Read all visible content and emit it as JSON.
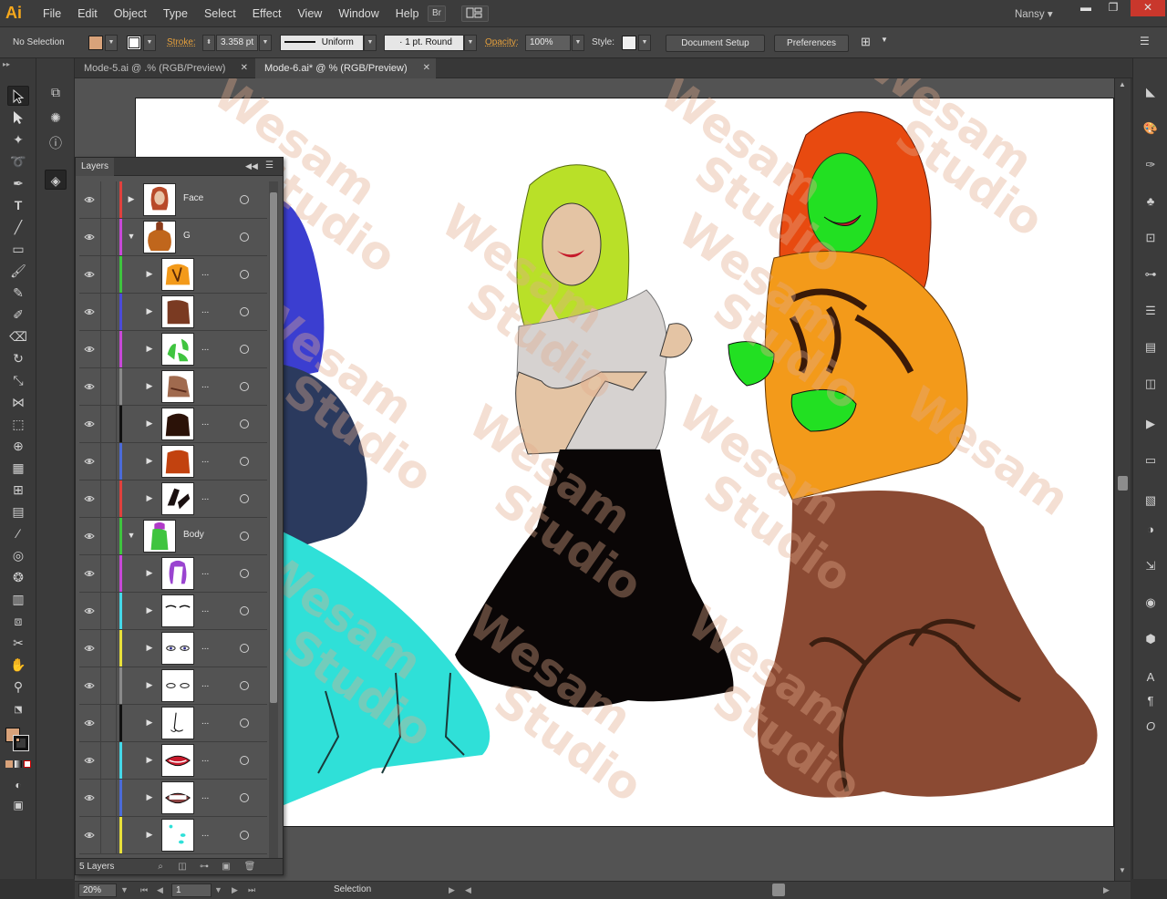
{
  "app": {
    "logo": "Ai",
    "user": "Nansy",
    "bridge_label": "Br"
  },
  "menu": [
    "File",
    "Edit",
    "Object",
    "Type",
    "Select",
    "Effect",
    "View",
    "Window",
    "Help"
  ],
  "control_bar": {
    "selection_state": "No Selection",
    "stroke_label": "Stroke:",
    "stroke_weight": "3.358 pt",
    "stroke_profile": "Uniform",
    "brush": "1 pt. Round",
    "opacity_label": "Opacity:",
    "opacity_value": "100%",
    "style_label": "Style:",
    "document_setup": "Document Setup",
    "preferences": "Preferences",
    "fill_color": "#d8a27a"
  },
  "tabs": [
    {
      "label": "Mode-5.ai @ .% (RGB/Preview)",
      "active": false
    },
    {
      "label": "Mode-6.ai* @ % (RGB/Preview)",
      "active": true
    }
  ],
  "watermark": {
    "line1": "Wesam",
    "line2": "Studio"
  },
  "layers_panel": {
    "title": "Layers",
    "count_label": "5 Layers",
    "rows": [
      {
        "name": "Face",
        "color": "#e0413d",
        "indent": 0,
        "expanded": false,
        "thumb": "face"
      },
      {
        "name": "G",
        "color": "#c848d8",
        "indent": 0,
        "expanded": true,
        "thumb": "g"
      },
      {
        "name": "...",
        "color": "#3fc43f",
        "indent": 1,
        "expanded": false,
        "thumb": "orange"
      },
      {
        "name": "...",
        "color": "#4b4bd8",
        "indent": 1,
        "expanded": false,
        "thumb": "brown"
      },
      {
        "name": "...",
        "color": "#c848d8",
        "indent": 1,
        "expanded": false,
        "thumb": "green"
      },
      {
        "name": "...",
        "color": "#8a8a8a",
        "indent": 1,
        "expanded": false,
        "thumb": "brownlight"
      },
      {
        "name": "...",
        "color": "#111111",
        "indent": 1,
        "expanded": false,
        "thumb": "dark"
      },
      {
        "name": "...",
        "color": "#4b6bd8",
        "indent": 1,
        "expanded": false,
        "thumb": "rust"
      },
      {
        "name": "...",
        "color": "#e0413d",
        "indent": 1,
        "expanded": false,
        "thumb": "boots"
      },
      {
        "name": "Body",
        "color": "#3fc43f",
        "indent": 0,
        "expanded": true,
        "thumb": "body"
      },
      {
        "name": "...",
        "color": "#c848d8",
        "indent": 1,
        "expanded": false,
        "thumb": "hair"
      },
      {
        "name": "...",
        "color": "#45d8e8",
        "indent": 1,
        "expanded": false,
        "thumb": "brows"
      },
      {
        "name": "...",
        "color": "#e8e03a",
        "indent": 1,
        "expanded": false,
        "thumb": "eyes"
      },
      {
        "name": "...",
        "color": "#8a8a8a",
        "indent": 1,
        "expanded": false,
        "thumb": "eyes2"
      },
      {
        "name": "...",
        "color": "#111111",
        "indent": 1,
        "expanded": false,
        "thumb": "nose"
      },
      {
        "name": "...",
        "color": "#45d8e8",
        "indent": 1,
        "expanded": false,
        "thumb": "lips"
      },
      {
        "name": "...",
        "color": "#4b6bd8",
        "indent": 1,
        "expanded": false,
        "thumb": "teeth"
      },
      {
        "name": "...",
        "color": "#e8e03a",
        "indent": 1,
        "expanded": false,
        "thumb": "dots"
      }
    ]
  },
  "status_bar": {
    "zoom": "20%",
    "artboard": "1",
    "tool": "Selection"
  }
}
